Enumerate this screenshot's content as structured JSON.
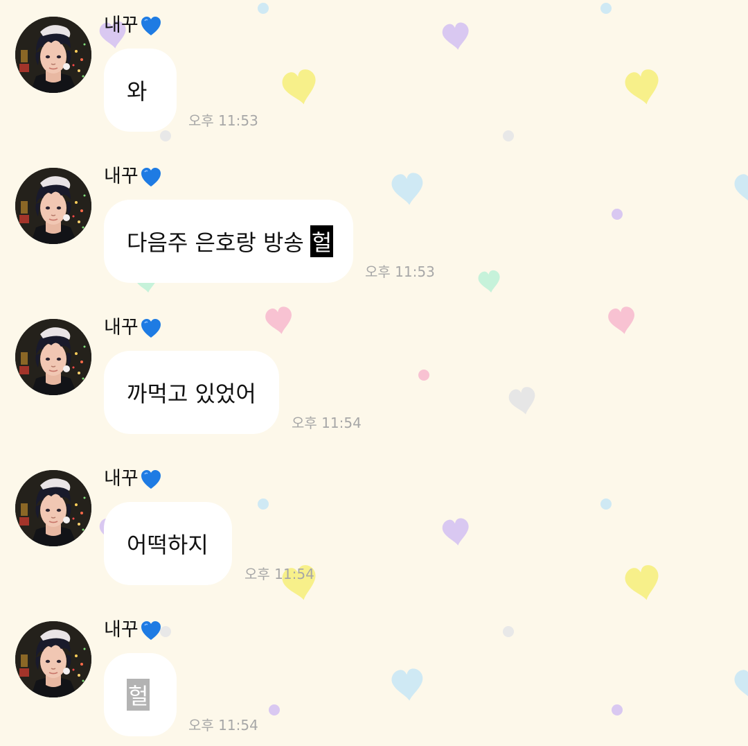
{
  "colors": {
    "background": "#fdf8ea",
    "bubble": "#ffffff",
    "timestamp": "#a7a7a7",
    "name_heart": "#1e7be3"
  },
  "messages": [
    {
      "sender": "내꾸",
      "sender_emoji": "blue-heart-icon",
      "text": "와",
      "highlight": "",
      "time": "오후 11:53"
    },
    {
      "sender": "내꾸",
      "sender_emoji": "blue-heart-icon",
      "text": "다음주 은호랑 방송",
      "highlight": "헐",
      "time": "오후 11:53"
    },
    {
      "sender": "내꾸",
      "sender_emoji": "blue-heart-icon",
      "text": "까먹고 있었어",
      "highlight": "",
      "time": "오후 11:54"
    },
    {
      "sender": "내꾸",
      "sender_emoji": "blue-heart-icon",
      "text": "어떡하지",
      "highlight": "",
      "time": "오후 11:54"
    },
    {
      "sender": "내꾸",
      "sender_emoji": "blue-heart-icon",
      "text": "",
      "highlight": "헐",
      "time": "오후 11:54"
    }
  ]
}
